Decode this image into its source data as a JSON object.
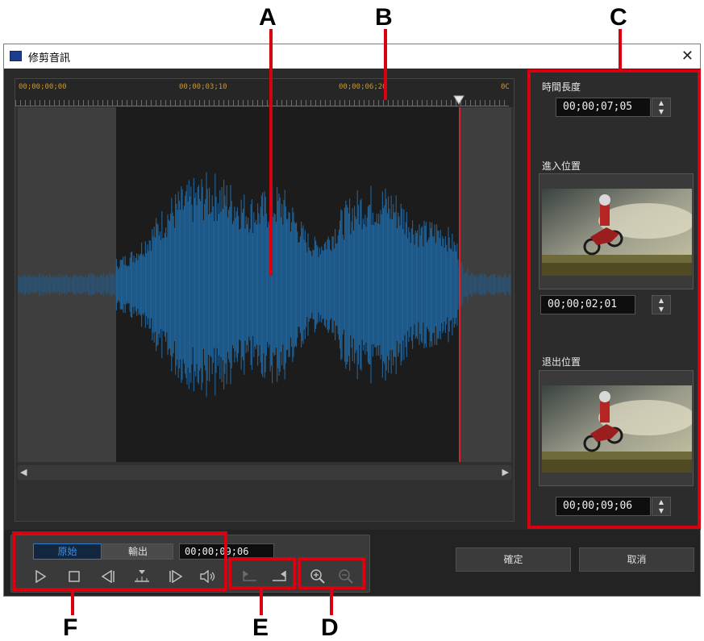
{
  "window": {
    "title": "修剪音訊",
    "close_glyph": "✕"
  },
  "ruler": {
    "labels": [
      "00;00;00;00",
      "00;00;03;10",
      "00;00;06;20",
      "0C"
    ]
  },
  "audio": {
    "waveform_color": "#1f5f93",
    "trim_in_fraction": 0.2,
    "trim_out_fraction": 0.894
  },
  "right_panel": {
    "duration_label": "時間長度",
    "duration_value": "00;00;07;05",
    "in_label": "進入位置",
    "in_value": "00;00;02;01",
    "out_label": "退出位置",
    "out_value": "00;00;09;06"
  },
  "controls": {
    "tab_original": "原始",
    "tab_output": "輸出",
    "timecode": "00;00;09;06",
    "icons": [
      "play-icon",
      "stop-icon",
      "previous-frame-icon",
      "mark-icon",
      "next-frame-icon",
      "volume-icon",
      "mark-in-icon",
      "mark-out-icon",
      "zoom-in-icon",
      "zoom-out-icon"
    ]
  },
  "dialog_buttons": {
    "ok": "確定",
    "cancel": "取消"
  },
  "callouts": {
    "a": "A",
    "b": "B",
    "c": "C",
    "d": "D",
    "e": "E",
    "f": "F"
  },
  "colors": {
    "annotation_red": "#d9000f",
    "accent_blue": "#2e78c8",
    "timecode_gold": "#c99a2a",
    "playhead_red": "#d9232e"
  }
}
